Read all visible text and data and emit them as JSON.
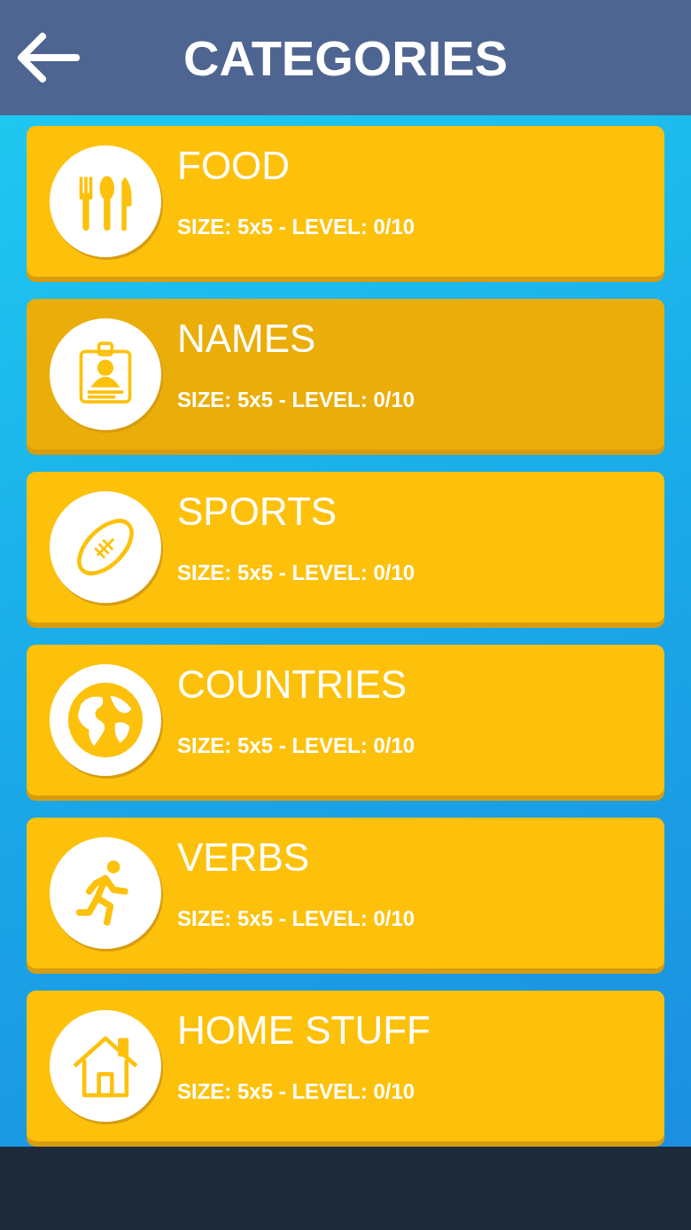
{
  "header": {
    "title": "CATEGORIES"
  },
  "categories": [
    {
      "kind": "food",
      "name": "FOOD",
      "info": "SIZE: 5x5 - LEVEL: 0/10",
      "selected": false
    },
    {
      "kind": "names",
      "name": "NAMES",
      "info": "SIZE: 5x5 - LEVEL: 0/10",
      "selected": true
    },
    {
      "kind": "sports",
      "name": "SPORTS",
      "info": "SIZE: 5x5 - LEVEL: 0/10",
      "selected": false
    },
    {
      "kind": "countries",
      "name": "COUNTRIES",
      "info": "SIZE: 5x5 - LEVEL: 0/10",
      "selected": false
    },
    {
      "kind": "verbs",
      "name": "VERBS",
      "info": "SIZE: 5x5 - LEVEL: 0/10",
      "selected": false
    },
    {
      "kind": "home",
      "name": "HOME STUFF",
      "info": "SIZE: 5x5 - LEVEL: 0/10",
      "selected": false
    }
  ]
}
